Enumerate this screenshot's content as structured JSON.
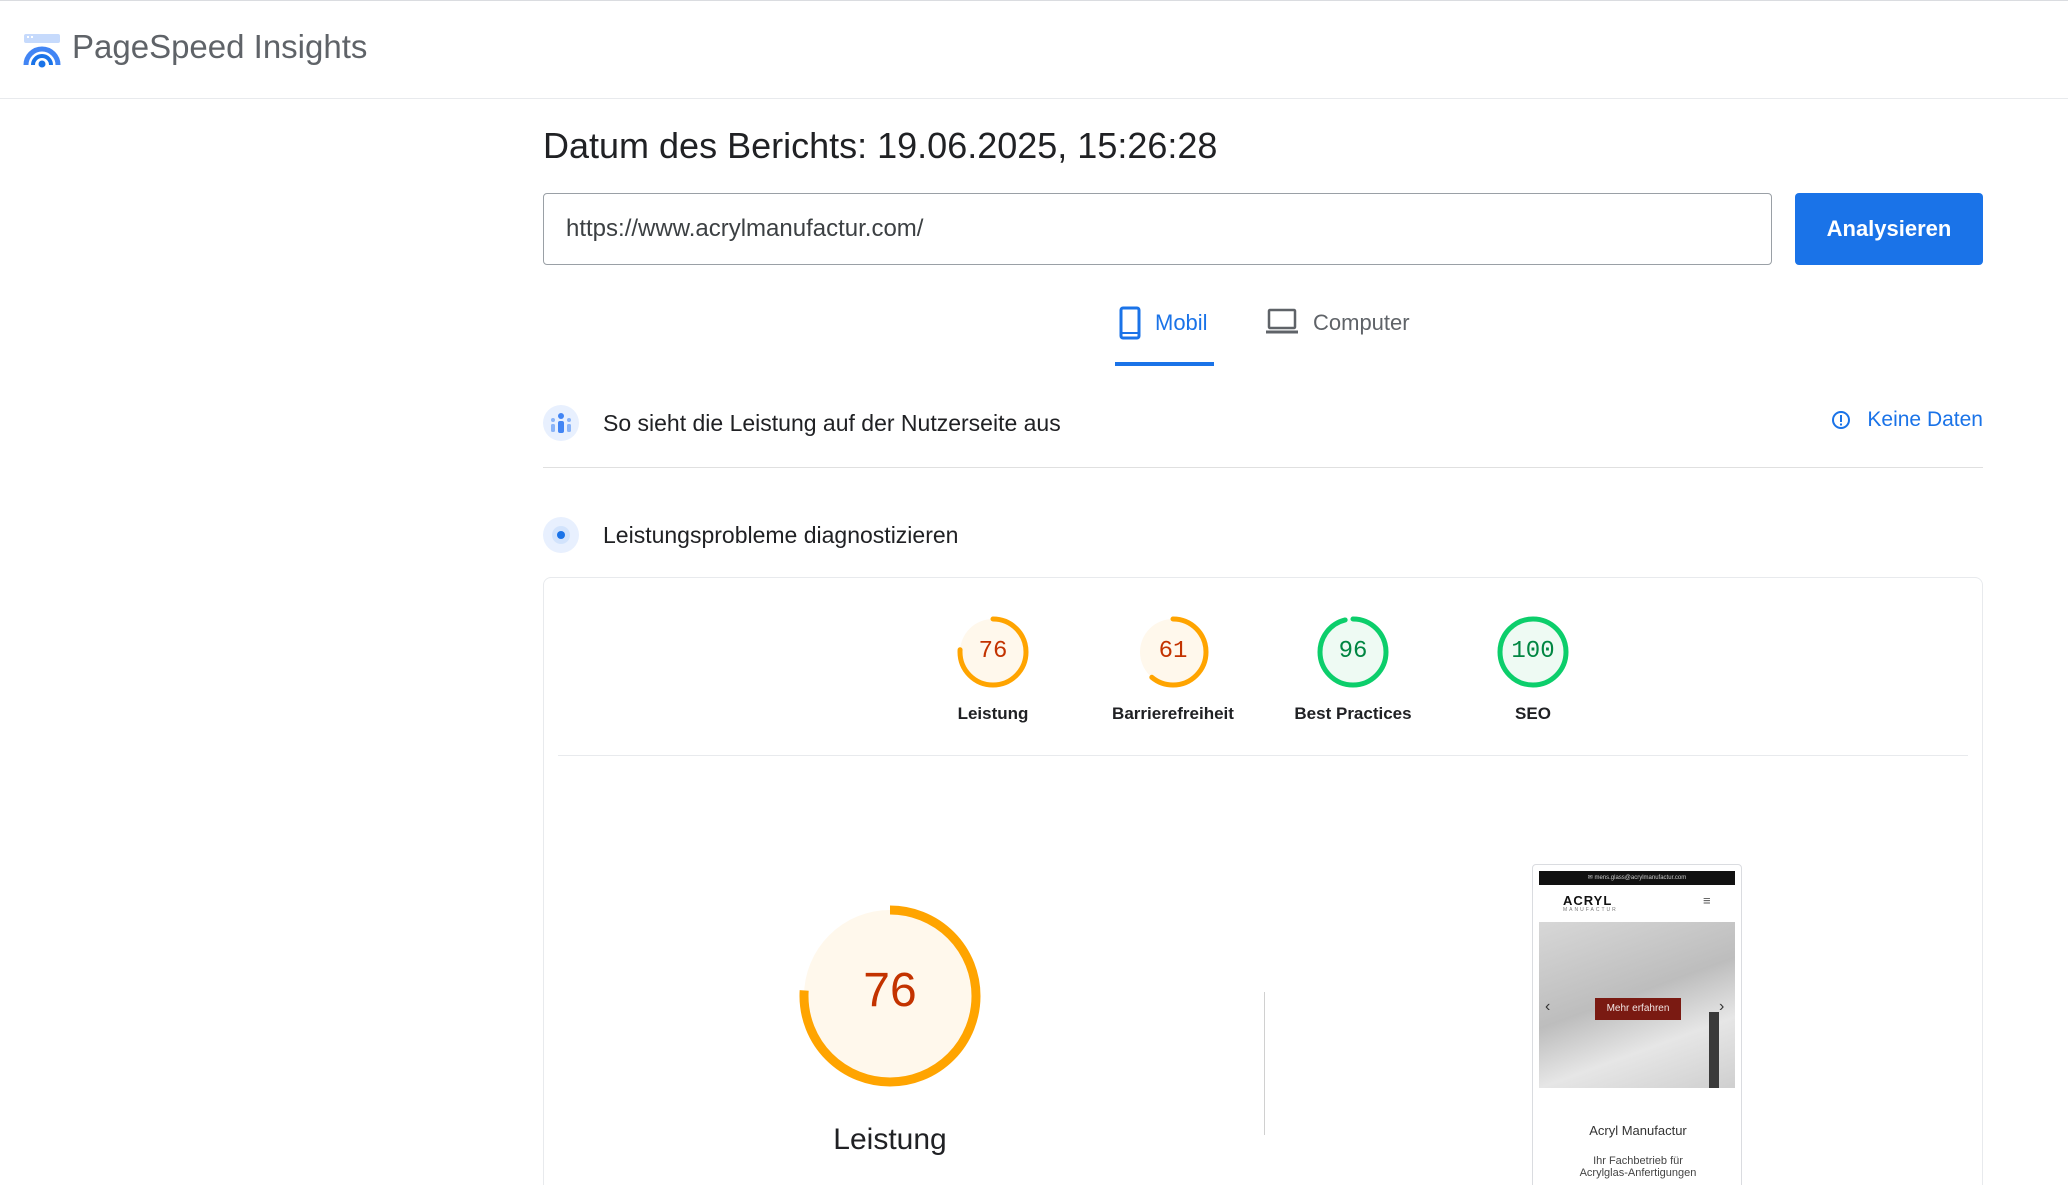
{
  "header": {
    "app_title": "PageSpeed Insights",
    "logo_icon": "pagespeed-logo-icon"
  },
  "report": {
    "date_label": "Datum des Berichts:",
    "date_value": "19.06.2025, 15:26:28"
  },
  "search": {
    "url_value": "https://www.acrylmanufactur.com/",
    "analyze_label": "Analysieren"
  },
  "tabs": [
    {
      "label": "Mobil",
      "icon": "smartphone-icon",
      "selected": true
    },
    {
      "label": "Computer",
      "icon": "laptop-icon",
      "selected": false
    }
  ],
  "sections": {
    "field_data": {
      "title": "So sieht die Leistung auf der Nutzerseite aus",
      "icon": "users-icon",
      "no_data_label": "Keine Daten",
      "no_data_icon": "info-icon"
    },
    "diagnose": {
      "title": "Leistungsprobleme diagnostizieren",
      "icon": "lighthouse-icon"
    }
  },
  "scores": [
    {
      "label": "Leistung",
      "value": "76",
      "color": "#ffa400",
      "text_color": "#c33300"
    },
    {
      "label": "Barrierefreiheit",
      "value": "61",
      "color": "#ffa400",
      "text_color": "#c33300"
    },
    {
      "label": "Best Practices",
      "value": "96",
      "color": "#0cce6b",
      "text_color": "#018642"
    },
    {
      "label": "SEO",
      "value": "100",
      "color": "#0cce6b",
      "text_color": "#018642"
    }
  ],
  "performance": {
    "value": "76",
    "label": "Leistung",
    "color": "#ffa400"
  },
  "screenshot": {
    "topbar_text": "✉ mens.glass@acrylmanufactur.com",
    "brand": "ACRYL",
    "brand_sub": "MANUFACTUR",
    "menu_icon": "hamburger-icon",
    "cta": "Mehr erfahren",
    "title": "Acryl Manufactur",
    "subtitle_line1": "Ihr Fachbetrieb für",
    "subtitle_line2": "Acrylglas-Anfertigungen"
  }
}
